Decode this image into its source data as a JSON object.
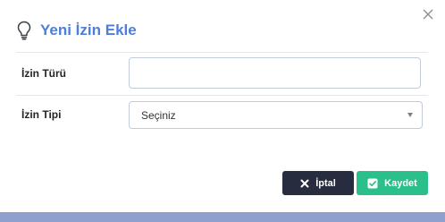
{
  "modal": {
    "title": "Yeni İzin Ekle",
    "close_icon": "close-icon",
    "title_icon": "lightbulb-icon"
  },
  "form": {
    "izin_turu": {
      "label": "İzin Türü",
      "value": "",
      "placeholder": ""
    },
    "izin_tipi": {
      "label": "İzin Tipi",
      "selected": "Seçiniz"
    }
  },
  "actions": {
    "cancel_label": "İptal",
    "save_label": "Kaydet"
  },
  "colors": {
    "title": "#4f7ed6",
    "cancel_bg": "#272c3f",
    "save_bg": "#2bbf8b",
    "backdrop": "#8fa0cf"
  }
}
